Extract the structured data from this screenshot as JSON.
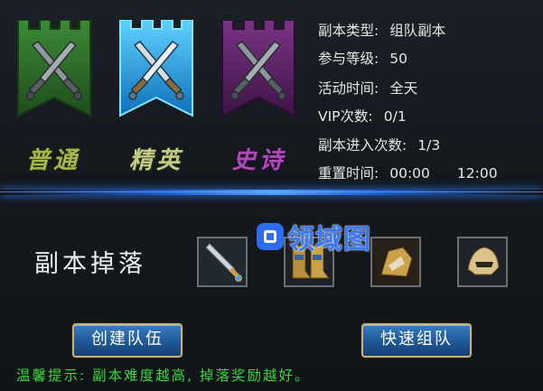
{
  "modes": [
    {
      "label": "普通",
      "color": "#2f6a2c"
    },
    {
      "label": "精英",
      "color": "#1aa3e8"
    },
    {
      "label": "史诗",
      "color": "#6a2a74"
    }
  ],
  "info": {
    "type_label": "副本类型:",
    "type_value": "组队副本",
    "level_label": "参与等级:",
    "level_value": "50",
    "time_label": "活动时间:",
    "time_value": "全天",
    "vip_label": "VIP次数:",
    "vip_value": "0/1",
    "entries_label": "副本进入次数:",
    "entries_value": "1/3",
    "reset_label": "重置时间:",
    "reset_value_1": "00:00",
    "reset_value_2": "12:00"
  },
  "drops": {
    "title": "副本掉落",
    "items": [
      {
        "icon": "sword-item-icon"
      },
      {
        "icon": "boots-item-icon"
      },
      {
        "icon": "gauntlet-item-icon"
      },
      {
        "icon": "helmet-item-icon"
      }
    ]
  },
  "watermark": {
    "text": "领域图"
  },
  "buttons": {
    "create_label": "创建队伍",
    "quick_label": "快速组队"
  },
  "tip": "温馨提示: 副本难度越高, 掉落奖励越好。"
}
